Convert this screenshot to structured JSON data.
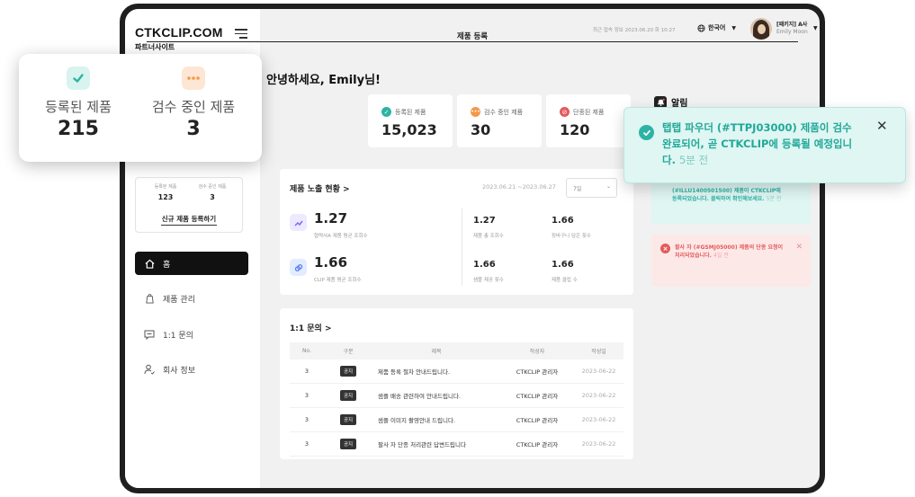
{
  "colors": {
    "teal": "#2db3a4",
    "orange": "#f39a4a",
    "red": "#e35b5b",
    "dark": "#111111",
    "purple": "#7b6cf0"
  },
  "sidebar": {
    "logo": "CTKCLIP.COM",
    "subtitle": "파트너사이트",
    "stats": {
      "registered_label": "등록된 제품",
      "registered_value": "123",
      "review_label": "검수 중인 제품",
      "review_value": "3"
    },
    "register_new": "신규 제품 등록하기",
    "nav": [
      {
        "label": "홈",
        "icon": "home-icon",
        "active": true
      },
      {
        "label": "제품 관리",
        "icon": "box-icon"
      },
      {
        "label": "1:1 문의",
        "icon": "chat-icon"
      },
      {
        "label": "회사 정보",
        "icon": "person-icon"
      }
    ]
  },
  "topbar": {
    "last_access": "최근 접속 정보 2023.06.20 화 10:27",
    "language": "한국어",
    "user_name": "[패키지] A사",
    "user_sub": "Emily Moon"
  },
  "greeting": "안녕하세요, Emily님!",
  "register_button": "제품 등록",
  "stats": [
    {
      "label": "등록된 제품",
      "value": "15,023",
      "icon": "check-icon"
    },
    {
      "label": "검수 중인 제품",
      "value": "30",
      "icon": "ellipsis-icon"
    },
    {
      "label": "단종된 제품",
      "value": "120",
      "icon": "block-icon"
    }
  ],
  "exposure": {
    "title": "제품 노출 현황 >",
    "date_range": "2023.06.21 ~2023.06.27",
    "period": "7일",
    "primary": [
      {
        "value": "1.27",
        "label": "협력사A 제품 평균 조회수",
        "icon": "trend-icon"
      },
      {
        "value": "1.66",
        "label": "CLIP 제품 평균 조회수",
        "icon": "link-icon"
      }
    ],
    "metrics": [
      {
        "value": "1.27",
        "label": "제품 총 조회수"
      },
      {
        "value": "1.66",
        "label": "장바구니 담은 횟수"
      },
      {
        "value": "1.66",
        "label": "샘플 제공 횟수"
      },
      {
        "value": "1.66",
        "label": "제품 클립 수"
      }
    ]
  },
  "qa": {
    "title": "1:1 문의 >",
    "headers": [
      "No.",
      "구분",
      "제목",
      "작성자",
      "작성일"
    ],
    "rows": [
      {
        "no": "3",
        "tag": "공지",
        "title": "제품 등록 절차 안내드립니다.",
        "author": "CTKCLIP 관리자",
        "date": "2023-06-22"
      },
      {
        "no": "3",
        "tag": "공지",
        "title": "샘플 배송 관련하여 안내드립니다.",
        "author": "CTKCLIP 관리자",
        "date": "2023-06-22"
      },
      {
        "no": "3",
        "tag": "공지",
        "title": "샘플 이미지 촬영안내 드립니다.",
        "author": "CTKCLIP 관리자",
        "date": "2023-06-22"
      },
      {
        "no": "3",
        "tag": "공지",
        "title": "팔사 자 단종 처리관련 답변드립니다",
        "author": "CTKCLIP 관리자",
        "date": "2023-06-22"
      }
    ]
  },
  "alarm": {
    "title": "알림",
    "note1": {
      "text": "(#ILLU1400501500) 제품이 CTKCLIP에 등록되었습니다. 클릭하여 확인해보세요.",
      "time": "5분 전"
    },
    "note2": {
      "text": "팔사 자 (#GSMJ05000) 제품의 단종 요청이 처리되었습니다.",
      "time": "4일 전"
    }
  },
  "toast": {
    "text": "탭탭 파우더 (#TTPJ03000) 제품이 검수 완료되어, 곧 CTKCLIP에 등록될 예정입니다.",
    "time": "5분 전"
  },
  "popup": {
    "registered_label": "등록된 제품",
    "registered_value": "215",
    "review_label": "검수 중인 제품",
    "review_value": "3"
  }
}
